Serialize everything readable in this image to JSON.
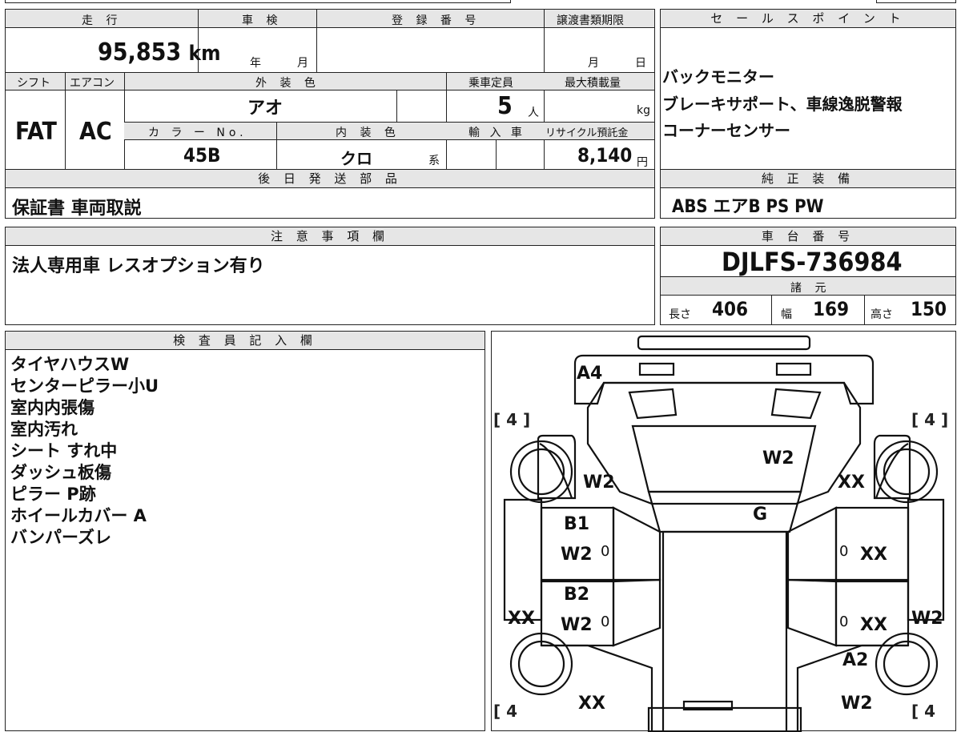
{
  "sheet": {
    "mileage_header": "走 行",
    "mileage_value": "95,853",
    "mileage_unit": "km",
    "inspection_header": "車 検",
    "inspection_year": "年",
    "inspection_month": "月",
    "registration_header": "登 録 番 号",
    "transfer_header": "譲渡書類期限",
    "transfer_month": "月",
    "transfer_day": "日",
    "shift_header": "シフト",
    "shift_value": "FAT",
    "ac_header": "エアコン",
    "ac_value": "AC",
    "exterior_header": "外 装 色",
    "exterior_value": "アオ",
    "capacity_header": "乗車定員",
    "capacity_value": "5",
    "capacity_unit": "人",
    "maxload_header": "最大積載量",
    "maxload_unit": "kg",
    "colorno_header": "カ ラ ー No.",
    "colorno_value": "45B",
    "interior_header": "内 装 色",
    "interior_value": "クロ",
    "interior_unit": "系",
    "import_header": "輸 入 車",
    "recycle_header": "リサイクル預託金",
    "recycle_value": "8,140",
    "recycle_unit": "円",
    "later_header": "後 日 発 送 部 品",
    "later_value": "保証書 車両取説",
    "notes_header": "注 意 事 項 欄",
    "notes_value": "法人専用車 レスオプション有り",
    "sales_header": "セ ー ル ス ポ イ ン ト",
    "sales_points": [
      "バックモニター",
      "ブレーキサポート、車線逸脱警報",
      "コーナーセンサー"
    ],
    "equipment_header": "純 正 装 備",
    "equipment_value": "ABS エアB PS PW",
    "chassis_header": "車 台 番 号",
    "chassis_value": "DJLFS-736984",
    "specs_header": "諸 元",
    "length_label": "長さ",
    "length_value": "406",
    "width_label": "幅",
    "width_value": "169",
    "height_label": "高さ",
    "height_value": "150",
    "inspector_header": "検 査 員 記 入 欄",
    "inspector_notes": [
      "タイヤハウスW",
      "センターピラー小U",
      "室内内張傷",
      "室内汚れ",
      "シート すれ中",
      "ダッシュ板傷",
      "ピラー P跡",
      "ホイールカバー A",
      "バンパーズレ"
    ]
  },
  "diagram": {
    "marks": {
      "front_bumper": "A4",
      "hood": "W2",
      "left_fender": "W2",
      "right_fender": "XX",
      "windshield": "G",
      "left_front_door_1": "B1",
      "left_front_door_2": "W2",
      "left_rear_door_1": "B2",
      "left_rear_door_2": "W2",
      "right_front_door": "XX",
      "right_rear_door": "XX",
      "left_side": "XX",
      "right_side": "W2",
      "right_rear": "A2",
      "left_rear_quarter": "XX",
      "right_rear_quarter": "W2",
      "zero_mark": "0"
    },
    "tire_fl": "[ 4 ]",
    "tire_fr": "[ 4 ]",
    "tire_rl": "[ 4",
    "tire_rr": "[ 4"
  }
}
